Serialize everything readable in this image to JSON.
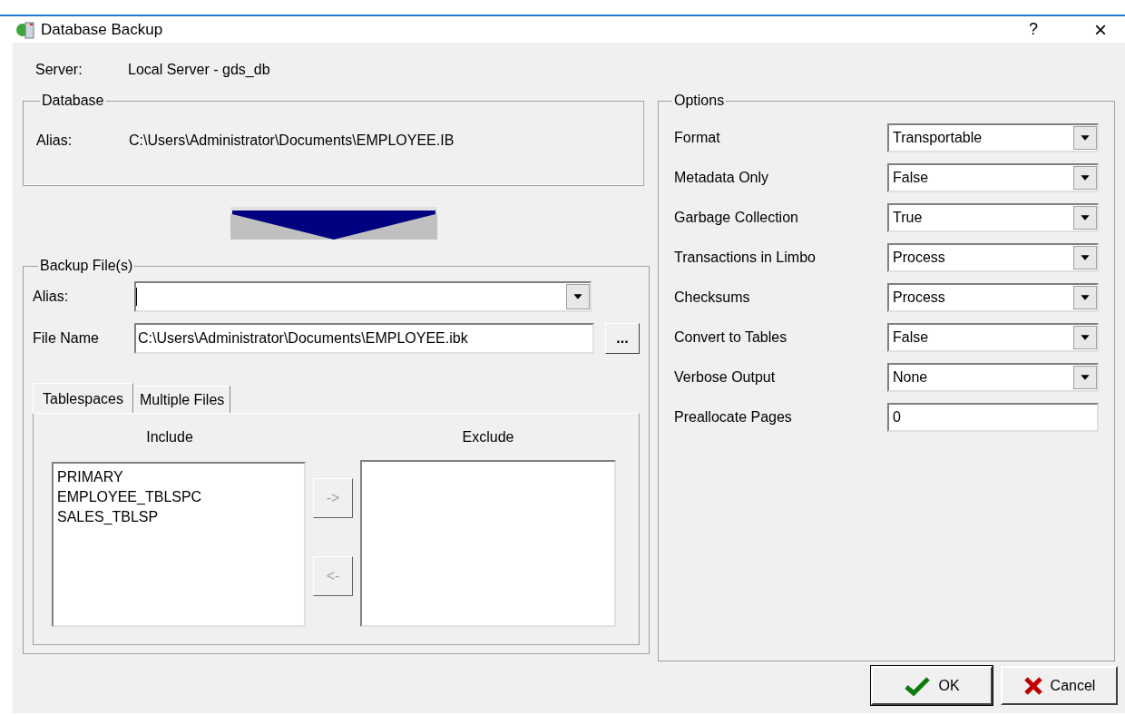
{
  "window": {
    "title": "Database Backup",
    "help": "?",
    "close": "×"
  },
  "server": {
    "label": "Server:",
    "value": "Local Server - gds_db"
  },
  "database": {
    "title": "Database",
    "alias_label": "Alias:",
    "alias_value": "C:\\Users\\Administrator\\Documents\\EMPLOYEE.IB"
  },
  "backup_files": {
    "title": "Backup File(s)",
    "alias_label": "Alias:",
    "file_name_label": "File Name",
    "file_name_value": "C:\\Users\\Administrator\\Documents\\EMPLOYEE.ibk",
    "browse": "...",
    "tabs": [
      {
        "label": "Tablespaces",
        "selected": true
      },
      {
        "label": "Multiple Files",
        "selected": false
      }
    ],
    "include_title": "Include",
    "exclude_title": "Exclude",
    "include_items": [
      "PRIMARY",
      "EMPLOYEE_TBLSPC",
      "SALES_TBLSP"
    ],
    "move_right": "->",
    "move_left": "<-"
  },
  "options": {
    "title": "Options",
    "rows": [
      {
        "label": "Format",
        "kind": "select",
        "value": "Transportable"
      },
      {
        "label": "Metadata Only",
        "kind": "select",
        "value": "False"
      },
      {
        "label": "Garbage Collection",
        "kind": "select",
        "value": "True"
      },
      {
        "label": "Transactions in Limbo",
        "kind": "select",
        "value": "Process"
      },
      {
        "label": "Checksums",
        "kind": "select",
        "value": "Process"
      },
      {
        "label": "Convert to Tables",
        "kind": "select",
        "value": "False"
      },
      {
        "label": "Verbose Output",
        "kind": "select",
        "value": "None"
      },
      {
        "label": "Preallocate Pages",
        "kind": "input",
        "value": "0"
      }
    ]
  },
  "buttons": [
    {
      "label": "OK",
      "kind": "ok"
    },
    {
      "label": "Cancel",
      "kind": "cancel"
    }
  ]
}
